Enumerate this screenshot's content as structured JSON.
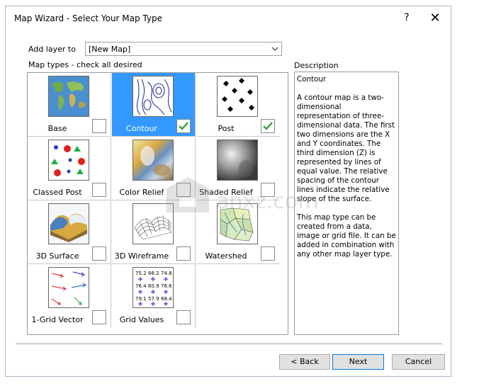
{
  "window": {
    "title": "Map Wizard - Select Your Map Type",
    "help_label": "?",
    "close_label": "✕"
  },
  "add_layer": {
    "label": "Add layer to",
    "value": "[New Map]"
  },
  "map_types_label": "Map types - check all desired",
  "map_types": [
    {
      "label": "Base",
      "icon": "world-map-icon",
      "checked": false,
      "selected": false
    },
    {
      "label": "Contour",
      "icon": "contour-lines-icon",
      "checked": true,
      "selected": true
    },
    {
      "label": "Post",
      "icon": "post-symbols-icon",
      "checked": true,
      "selected": false
    },
    {
      "label": "Classed Post",
      "icon": "classed-post-icon",
      "checked": false,
      "selected": false
    },
    {
      "label": "Color Relief",
      "icon": "color-relief-icon",
      "checked": false,
      "selected": false
    },
    {
      "label": "Shaded Relief",
      "icon": "shaded-relief-icon",
      "checked": false,
      "selected": false
    },
    {
      "label": "3D Surface",
      "icon": "3d-surface-icon",
      "checked": false,
      "selected": false
    },
    {
      "label": "3D Wireframe",
      "icon": "3d-wireframe-icon",
      "checked": false,
      "selected": false
    },
    {
      "label": "Watershed",
      "icon": "watershed-icon",
      "checked": false,
      "selected": false
    },
    {
      "label": "1-Grid Vector",
      "icon": "grid-vector-icon",
      "checked": false,
      "selected": false
    },
    {
      "label": "Grid Values",
      "icon": "grid-values-icon",
      "checked": false,
      "selected": false
    }
  ],
  "grid_values_sample": [
    "75.2",
    "66.2",
    "74.8",
    "76.4",
    "60.9",
    "78.6",
    "79.1",
    "57.9",
    "68.4"
  ],
  "description": {
    "label": "Description",
    "heading": "Contour",
    "para1": "A contour map is a two-dimensional representation of three-dimensional data. The first two dimensions are the X and Y coordinates. The third dimension (Z) is represented by lines of equal value. The relative spacing of the contour lines indicate the relative slope of the surface.",
    "para2": "This map type can be created from a data, image or grid file. It can be added in combination with any other map layer type."
  },
  "buttons": {
    "back": "< Back",
    "next": "Next",
    "cancel": "Cancel"
  },
  "watermark": "anxz.com",
  "colors": {
    "selection": "#3399ff",
    "check": "#3c9a3c",
    "primary_border": "#0078d7"
  }
}
